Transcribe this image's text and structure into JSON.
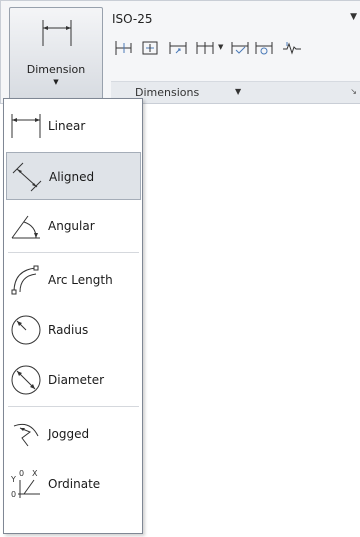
{
  "ribbon": {
    "big_button": {
      "label": "Dimension",
      "icon": "linear-dimension-icon"
    },
    "style_combo": {
      "value": "ISO-25"
    },
    "tools": [
      {
        "icon": "dim-tool-1-icon"
      },
      {
        "icon": "dim-tool-2-icon"
      },
      {
        "icon": "dim-tool-3-icon"
      },
      {
        "icon": "dim-tool-4-icon"
      },
      {
        "icon": "dim-tool-5-icon"
      },
      {
        "icon": "dim-tool-6-icon"
      },
      {
        "icon": "dim-tool-7-icon"
      }
    ],
    "panel_title": "Dimensions",
    "panel_title_prefix_hidden": "D"
  },
  "menu": {
    "items": [
      {
        "label": "Linear",
        "icon": "linear-icon"
      },
      {
        "label": "Aligned",
        "icon": "aligned-icon",
        "selected": true
      },
      {
        "label": "Angular",
        "icon": "angular-icon"
      },
      {
        "label": "Arc Length",
        "icon": "arc-length-icon"
      },
      {
        "label": "Radius",
        "icon": "radius-icon"
      },
      {
        "label": "Diameter",
        "icon": "diameter-icon"
      },
      {
        "label": "Jogged",
        "icon": "jogged-icon"
      },
      {
        "label": "Ordinate",
        "icon": "ordinate-icon"
      }
    ]
  },
  "colors": {
    "accent_border": "#a5adb8",
    "selected_bg": "#dfe3e8",
    "ribbon_bg": "#f5f6f8"
  }
}
